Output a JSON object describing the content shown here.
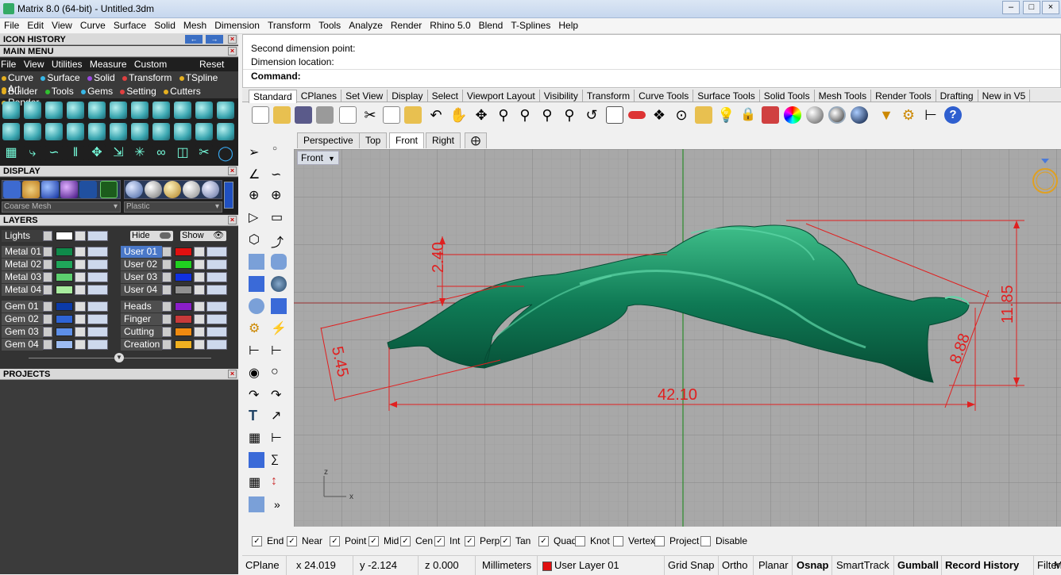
{
  "window": {
    "title": "Matrix 8.0 (64-bit) - Untitled.3dm"
  },
  "menubar": [
    "File",
    "Edit",
    "View",
    "Curve",
    "Surface",
    "Solid",
    "Mesh",
    "Dimension",
    "Transform",
    "Tools",
    "Analyze",
    "Render",
    "Rhino 5.0",
    "Blend",
    "T-Splines",
    "Help"
  ],
  "left": {
    "icon_history": "ICON HISTORY",
    "main_menu": "MAIN MENU",
    "mm_row1": [
      "File",
      "View",
      "Utilities",
      "Measure",
      "Custom"
    ],
    "mm_reset": "Reset",
    "mm_row2": [
      "Curve",
      "Surface",
      "Solid",
      "Transform",
      "TSpline",
      "Art"
    ],
    "mm_row3": [
      "Builder",
      "Tools",
      "Gems",
      "Setting",
      "Cutters",
      "Render"
    ],
    "display": "DISPLAY",
    "display_mesh": "Coarse Mesh",
    "display_material": "Plastic",
    "layers": "LAYERS",
    "lights": "Lights",
    "hide": "Hide",
    "show": "Show",
    "layers_left": [
      {
        "name": "Metal 01",
        "color": "#0f8a4a"
      },
      {
        "name": "Metal 02",
        "color": "#1fa65a"
      },
      {
        "name": "Metal 03",
        "color": "#5ccf6e"
      },
      {
        "name": "Metal 04",
        "color": "#a8ec9e"
      },
      {
        "name": "Gem 01",
        "color": "#0b3aa8"
      },
      {
        "name": "Gem 02",
        "color": "#2e64d6"
      },
      {
        "name": "Gem 03",
        "color": "#5d8fe8"
      },
      {
        "name": "Gem 04",
        "color": "#9dbcf2"
      }
    ],
    "layers_right": [
      {
        "name": "User 01",
        "color": "#e01010"
      },
      {
        "name": "User 02",
        "color": "#20d020"
      },
      {
        "name": "User 03",
        "color": "#1030e0"
      },
      {
        "name": "User 04",
        "color": "#909090"
      },
      {
        "name": "Heads",
        "color": "#8a1ec8"
      },
      {
        "name": "Finger",
        "color": "#c83a3a"
      },
      {
        "name": "Cutting",
        "color": "#f08a10"
      },
      {
        "name": "Creation",
        "color": "#f0b020"
      }
    ],
    "projects": "PROJECTS"
  },
  "command": {
    "line1": "Second dimension point:",
    "line2": "Dimension location:",
    "prompt": "Command:"
  },
  "toolbar_tabs": [
    "Standard",
    "CPlanes",
    "Set View",
    "Display",
    "Select",
    "Viewport Layout",
    "Visibility",
    "Transform",
    "Curve Tools",
    "Surface Tools",
    "Solid Tools",
    "Mesh Tools",
    "Render Tools",
    "Drafting",
    "New in V5"
  ],
  "viewport_tabs": [
    "Perspective",
    "Top",
    "Front",
    "Right"
  ],
  "viewport_label": "Front",
  "dimensions": {
    "d1": "2.40",
    "d2": "5.45",
    "d3": "42.10",
    "d4": "8.88",
    "d5": "11.85"
  },
  "axis": {
    "z": "z",
    "x": "x"
  },
  "osnap": [
    {
      "label": "End",
      "checked": true
    },
    {
      "label": "Near",
      "checked": true
    },
    {
      "label": "Point",
      "checked": true
    },
    {
      "label": "Mid",
      "checked": true
    },
    {
      "label": "Cen",
      "checked": true
    },
    {
      "label": "Int",
      "checked": true
    },
    {
      "label": "Perp",
      "checked": true
    },
    {
      "label": "Tan",
      "checked": true
    },
    {
      "label": "Quad",
      "checked": true
    },
    {
      "label": "Knot",
      "checked": false
    },
    {
      "label": "Vertex",
      "checked": false
    },
    {
      "label": "Project",
      "checked": false
    },
    {
      "label": "Disable",
      "checked": false
    }
  ],
  "status": {
    "cplane": "CPlane",
    "x": "x 24.019",
    "y": "y -2.124",
    "z": "z 0.000",
    "units": "Millimeters",
    "layer": "User Layer 01",
    "grid_snap": "Grid Snap",
    "ortho": "Ortho",
    "planar": "Planar",
    "osnap": "Osnap",
    "smarttrack": "SmartTrack",
    "gumball": "Gumball",
    "record_history": "Record History",
    "filter": "Filter",
    "more": "M"
  }
}
